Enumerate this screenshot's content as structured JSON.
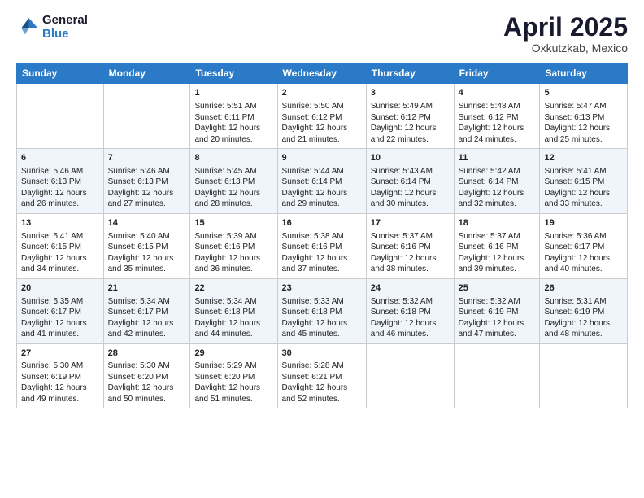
{
  "logo": {
    "line1": "General",
    "line2": "Blue"
  },
  "title": "April 2025",
  "subtitle": "Oxkutzkab, Mexico",
  "days_of_week": [
    "Sunday",
    "Monday",
    "Tuesday",
    "Wednesday",
    "Thursday",
    "Friday",
    "Saturday"
  ],
  "weeks": [
    [
      {
        "day": "",
        "info": ""
      },
      {
        "day": "",
        "info": ""
      },
      {
        "day": "1",
        "info": "Sunrise: 5:51 AM\nSunset: 6:11 PM\nDaylight: 12 hours and 20 minutes."
      },
      {
        "day": "2",
        "info": "Sunrise: 5:50 AM\nSunset: 6:12 PM\nDaylight: 12 hours and 21 minutes."
      },
      {
        "day": "3",
        "info": "Sunrise: 5:49 AM\nSunset: 6:12 PM\nDaylight: 12 hours and 22 minutes."
      },
      {
        "day": "4",
        "info": "Sunrise: 5:48 AM\nSunset: 6:12 PM\nDaylight: 12 hours and 24 minutes."
      },
      {
        "day": "5",
        "info": "Sunrise: 5:47 AM\nSunset: 6:13 PM\nDaylight: 12 hours and 25 minutes."
      }
    ],
    [
      {
        "day": "6",
        "info": "Sunrise: 5:46 AM\nSunset: 6:13 PM\nDaylight: 12 hours and 26 minutes."
      },
      {
        "day": "7",
        "info": "Sunrise: 5:46 AM\nSunset: 6:13 PM\nDaylight: 12 hours and 27 minutes."
      },
      {
        "day": "8",
        "info": "Sunrise: 5:45 AM\nSunset: 6:13 PM\nDaylight: 12 hours and 28 minutes."
      },
      {
        "day": "9",
        "info": "Sunrise: 5:44 AM\nSunset: 6:14 PM\nDaylight: 12 hours and 29 minutes."
      },
      {
        "day": "10",
        "info": "Sunrise: 5:43 AM\nSunset: 6:14 PM\nDaylight: 12 hours and 30 minutes."
      },
      {
        "day": "11",
        "info": "Sunrise: 5:42 AM\nSunset: 6:14 PM\nDaylight: 12 hours and 32 minutes."
      },
      {
        "day": "12",
        "info": "Sunrise: 5:41 AM\nSunset: 6:15 PM\nDaylight: 12 hours and 33 minutes."
      }
    ],
    [
      {
        "day": "13",
        "info": "Sunrise: 5:41 AM\nSunset: 6:15 PM\nDaylight: 12 hours and 34 minutes."
      },
      {
        "day": "14",
        "info": "Sunrise: 5:40 AM\nSunset: 6:15 PM\nDaylight: 12 hours and 35 minutes."
      },
      {
        "day": "15",
        "info": "Sunrise: 5:39 AM\nSunset: 6:16 PM\nDaylight: 12 hours and 36 minutes."
      },
      {
        "day": "16",
        "info": "Sunrise: 5:38 AM\nSunset: 6:16 PM\nDaylight: 12 hours and 37 minutes."
      },
      {
        "day": "17",
        "info": "Sunrise: 5:37 AM\nSunset: 6:16 PM\nDaylight: 12 hours and 38 minutes."
      },
      {
        "day": "18",
        "info": "Sunrise: 5:37 AM\nSunset: 6:16 PM\nDaylight: 12 hours and 39 minutes."
      },
      {
        "day": "19",
        "info": "Sunrise: 5:36 AM\nSunset: 6:17 PM\nDaylight: 12 hours and 40 minutes."
      }
    ],
    [
      {
        "day": "20",
        "info": "Sunrise: 5:35 AM\nSunset: 6:17 PM\nDaylight: 12 hours and 41 minutes."
      },
      {
        "day": "21",
        "info": "Sunrise: 5:34 AM\nSunset: 6:17 PM\nDaylight: 12 hours and 42 minutes."
      },
      {
        "day": "22",
        "info": "Sunrise: 5:34 AM\nSunset: 6:18 PM\nDaylight: 12 hours and 44 minutes."
      },
      {
        "day": "23",
        "info": "Sunrise: 5:33 AM\nSunset: 6:18 PM\nDaylight: 12 hours and 45 minutes."
      },
      {
        "day": "24",
        "info": "Sunrise: 5:32 AM\nSunset: 6:18 PM\nDaylight: 12 hours and 46 minutes."
      },
      {
        "day": "25",
        "info": "Sunrise: 5:32 AM\nSunset: 6:19 PM\nDaylight: 12 hours and 47 minutes."
      },
      {
        "day": "26",
        "info": "Sunrise: 5:31 AM\nSunset: 6:19 PM\nDaylight: 12 hours and 48 minutes."
      }
    ],
    [
      {
        "day": "27",
        "info": "Sunrise: 5:30 AM\nSunset: 6:19 PM\nDaylight: 12 hours and 49 minutes."
      },
      {
        "day": "28",
        "info": "Sunrise: 5:30 AM\nSunset: 6:20 PM\nDaylight: 12 hours and 50 minutes."
      },
      {
        "day": "29",
        "info": "Sunrise: 5:29 AM\nSunset: 6:20 PM\nDaylight: 12 hours and 51 minutes."
      },
      {
        "day": "30",
        "info": "Sunrise: 5:28 AM\nSunset: 6:21 PM\nDaylight: 12 hours and 52 minutes."
      },
      {
        "day": "",
        "info": ""
      },
      {
        "day": "",
        "info": ""
      },
      {
        "day": "",
        "info": ""
      }
    ]
  ]
}
